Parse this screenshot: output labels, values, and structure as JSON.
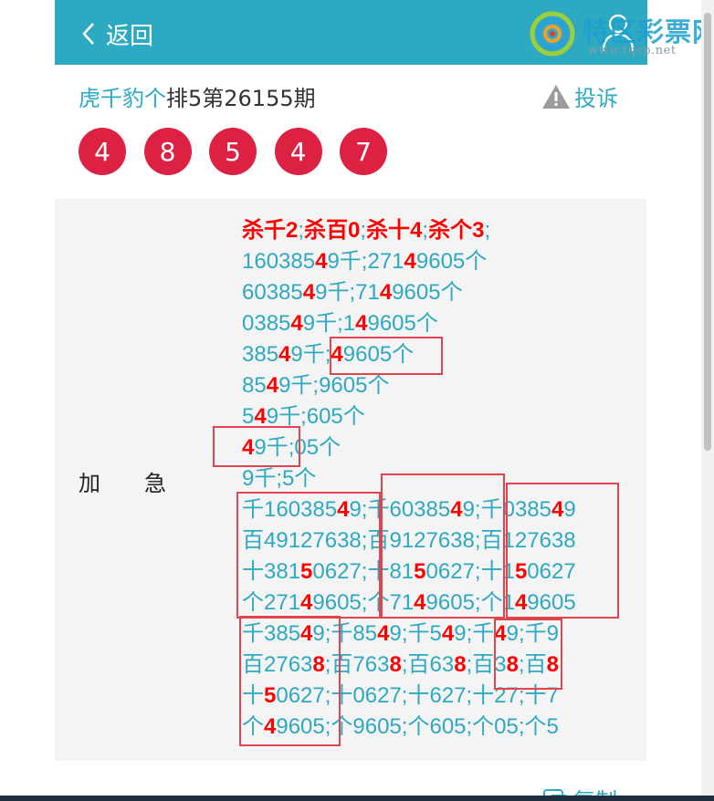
{
  "header": {
    "back_label": "返回"
  },
  "logo": {
    "title": "特区彩票网",
    "url": "www.tqcp.net"
  },
  "title": {
    "prefix": "虎千豹个",
    "rest": "排5第26155期"
  },
  "complain_label": "投诉",
  "balls": [
    "4",
    "8",
    "5",
    "4",
    "7"
  ],
  "label": "加　　急",
  "lines": [
    [
      [
        "r",
        "杀千2"
      ],
      [
        "t",
        ";"
      ],
      [
        "r",
        "杀百0"
      ],
      [
        "t",
        ";"
      ],
      [
        "r",
        "杀十4"
      ],
      [
        "t",
        ";"
      ],
      [
        "r",
        "杀个3"
      ],
      [
        "t",
        ";"
      ]
    ],
    [
      [
        "t",
        "160385"
      ],
      [
        "r",
        "4"
      ],
      [
        "t",
        "9千;271"
      ],
      [
        "r",
        "4"
      ],
      [
        "t",
        "9605个"
      ]
    ],
    [
      [
        "t",
        "60385"
      ],
      [
        "r",
        "4"
      ],
      [
        "t",
        "9千;71"
      ],
      [
        "r",
        "4"
      ],
      [
        "t",
        "9605个"
      ]
    ],
    [
      [
        "t",
        "0385"
      ],
      [
        "r",
        "4"
      ],
      [
        "t",
        "9千;1"
      ],
      [
        "r",
        "4"
      ],
      [
        "t",
        "9605个"
      ]
    ],
    [
      [
        "t",
        "385"
      ],
      [
        "r",
        "4"
      ],
      [
        "t",
        "9千;"
      ],
      [
        "r",
        "4"
      ],
      [
        "t",
        "9605个"
      ]
    ],
    [
      [
        "t",
        "85"
      ],
      [
        "r",
        "4"
      ],
      [
        "t",
        "9千;9605个"
      ]
    ],
    [
      [
        "t",
        "5"
      ],
      [
        "r",
        "4"
      ],
      [
        "t",
        "9千;605个"
      ]
    ],
    [
      [
        "r",
        "4"
      ],
      [
        "t",
        "9千;05个"
      ]
    ],
    [
      [
        "t",
        "9千;5个"
      ]
    ],
    [
      [
        "t",
        "千160385"
      ],
      [
        "r",
        "4"
      ],
      [
        "t",
        "9;千60385"
      ],
      [
        "r",
        "4"
      ],
      [
        "t",
        "9;千0385"
      ],
      [
        "r",
        "4"
      ],
      [
        "t",
        "9"
      ]
    ],
    [
      [
        "t",
        "百49127638;百9127638;百127638"
      ]
    ],
    [
      [
        "t",
        "十381"
      ],
      [
        "r",
        "5"
      ],
      [
        "t",
        "0627;十81"
      ],
      [
        "r",
        "5"
      ],
      [
        "t",
        "0627;十1"
      ],
      [
        "r",
        "5"
      ],
      [
        "t",
        "0627"
      ]
    ],
    [
      [
        "t",
        "个271"
      ],
      [
        "r",
        "4"
      ],
      [
        "t",
        "9605;个71"
      ],
      [
        "r",
        "4"
      ],
      [
        "t",
        "9605;个1"
      ],
      [
        "r",
        "4"
      ],
      [
        "t",
        "9605"
      ]
    ],
    [
      [
        "t",
        "千385"
      ],
      [
        "r",
        "4"
      ],
      [
        "t",
        "9;千85"
      ],
      [
        "r",
        "4"
      ],
      [
        "t",
        "9;千5"
      ],
      [
        "r",
        "4"
      ],
      [
        "t",
        "9;千"
      ],
      [
        "r",
        "4"
      ],
      [
        "t",
        "9;千9"
      ]
    ],
    [
      [
        "t",
        "百2763"
      ],
      [
        "r",
        "8"
      ],
      [
        "t",
        ";百763"
      ],
      [
        "r",
        "8"
      ],
      [
        "t",
        ";百63"
      ],
      [
        "r",
        "8"
      ],
      [
        "t",
        ";百3"
      ],
      [
        "r",
        "8"
      ],
      [
        "t",
        ";百"
      ],
      [
        "r",
        "8"
      ]
    ],
    [
      [
        "t",
        "十"
      ],
      [
        "r",
        "5"
      ],
      [
        "t",
        "0627;十0627;十627;十27;十7"
      ]
    ],
    [
      [
        "t",
        "个"
      ],
      [
        "r",
        "4"
      ],
      [
        "t",
        "9605;个9605;个605;个05;个5"
      ]
    ]
  ],
  "copy_label": "复制",
  "colors": {
    "header": "#2ea9c2",
    "ball": "#dd2143",
    "highlight": "#ff0000",
    "box": "#e0444e",
    "panel": "#f4f4f4"
  }
}
